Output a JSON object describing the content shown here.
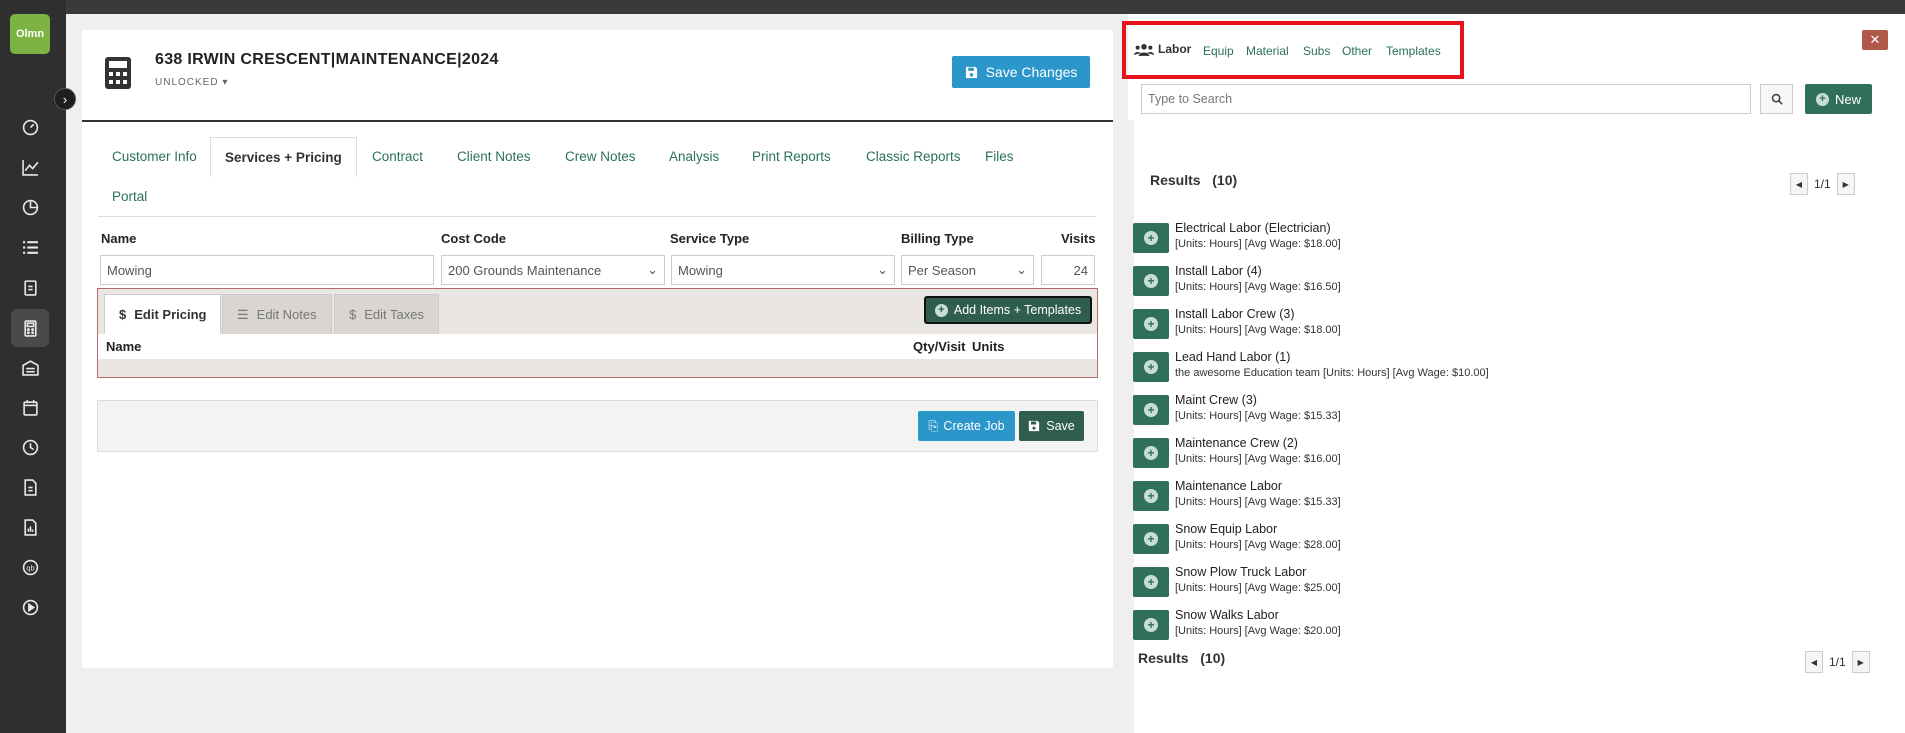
{
  "app": {
    "logo_text": "Olmn"
  },
  "nav": {
    "icons": [
      "dashboard-icon",
      "chart-line-icon",
      "pie-chart-icon",
      "list-icon",
      "clipboard-icon",
      "calculator-icon",
      "warehouse-icon",
      "calendar-icon",
      "clock-icon",
      "invoice-icon",
      "report-icon",
      "qb-icon",
      "play-icon"
    ]
  },
  "header": {
    "title": "638 IRWIN CRESCENT|MAINTENANCE|2024",
    "status": "UNLOCKED",
    "save_changes": "Save Changes"
  },
  "tabs": [
    {
      "label": "Customer Info"
    },
    {
      "label": "Services + Pricing",
      "active": true
    },
    {
      "label": "Contract"
    },
    {
      "label": "Client Notes"
    },
    {
      "label": "Crew Notes"
    },
    {
      "label": "Analysis"
    },
    {
      "label": "Print Reports"
    },
    {
      "label": "Classic Reports"
    },
    {
      "label": "Files"
    },
    {
      "label": "Portal"
    }
  ],
  "service_grid": {
    "headers": {
      "name": "Name",
      "cost_code": "Cost Code",
      "service_type": "Service Type",
      "billing_type": "Billing Type",
      "visits": "Visits"
    },
    "row": {
      "name": "Mowing",
      "cost_code": "200 Grounds Maintenance",
      "service_type": "Mowing",
      "billing_type": "Per Season",
      "visits": "24"
    }
  },
  "sub_tabs": {
    "edit_pricing": "Edit Pricing",
    "edit_notes": "Edit Notes",
    "edit_taxes": "Edit Taxes",
    "add_items": "Add Items + Templates",
    "col_name": "Name",
    "col_qty": "Qty/Visit",
    "col_units": "Units"
  },
  "actions": {
    "create_job": "Create Job",
    "save": "Save"
  },
  "right_panel": {
    "type_tabs": [
      "Labor",
      "Equip",
      "Material",
      "Subs",
      "Other",
      "Templates"
    ],
    "active_type": "Labor",
    "search_placeholder": "Type to Search",
    "new_label": "New",
    "results_label": "Results",
    "results_count": "(10)",
    "pager": "1/1",
    "items": [
      {
        "name": "Electrical Labor (Electrician)",
        "detail": "[Units: Hours] [Avg Wage: $18.00]"
      },
      {
        "name": "Install Labor (4)",
        "detail": "[Units: Hours] [Avg Wage: $16.50]"
      },
      {
        "name": "Install Labor Crew (3)",
        "detail": "[Units: Hours] [Avg Wage: $18.00]"
      },
      {
        "name": "Lead Hand Labor (1)",
        "detail": "the awesome Education team [Units: Hours] [Avg Wage: $10.00]"
      },
      {
        "name": "Maint Crew (3)",
        "detail": "[Units: Hours] [Avg Wage: $15.33]"
      },
      {
        "name": "Maintenance Crew (2)",
        "detail": "[Units: Hours] [Avg Wage: $16.00]"
      },
      {
        "name": "Maintenance Labor",
        "detail": "[Units: Hours] [Avg Wage: $15.33]"
      },
      {
        "name": "Snow Equip Labor",
        "detail": "[Units: Hours] [Avg Wage: $28.00]"
      },
      {
        "name": "Snow Plow Truck Labor",
        "detail": "[Units: Hours] [Avg Wage: $25.00]"
      },
      {
        "name": "Snow Walks Labor",
        "detail": "[Units: Hours] [Avg Wage: $20.00]"
      }
    ]
  },
  "colors": {
    "accent_green": "#2f6f5c",
    "accent_blue": "#2b96c9",
    "highlight_red": "#e8121b",
    "logo_green": "#7cb342"
  }
}
